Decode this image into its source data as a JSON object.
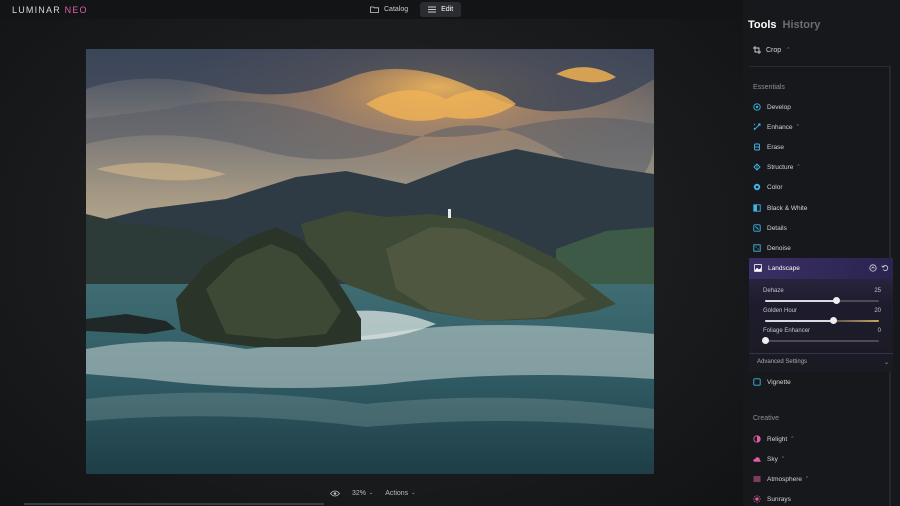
{
  "app": {
    "logo_main": "LUMINAR",
    "logo_accent": "NEO"
  },
  "modes": [
    {
      "label": "Catalog",
      "icon": "folder-icon",
      "active": false
    },
    {
      "label": "Edit",
      "icon": "sliders-icon",
      "active": true
    }
  ],
  "window_controls": [
    "share-icon",
    "minimize-icon",
    "maximize-icon",
    "close-icon"
  ],
  "panel": {
    "tabs": {
      "tools": "Tools",
      "history": "History"
    },
    "crop": {
      "label": "Crop"
    },
    "essentials": {
      "title": "Essentials",
      "items": [
        {
          "label": "Develop",
          "icon": "develop-icon",
          "color": "#3db7e8"
        },
        {
          "label": "Enhance",
          "icon": "enhance-icon",
          "color": "#3db7e8",
          "dropdown": true
        },
        {
          "label": "Erase",
          "icon": "erase-icon",
          "color": "#3db7e8"
        },
        {
          "label": "Structure",
          "icon": "structure-icon",
          "color": "#3db7e8",
          "dropdown": true
        },
        {
          "label": "Color",
          "icon": "color-icon",
          "color": "#3db7e8"
        },
        {
          "label": "Black & White",
          "icon": "black-white-icon",
          "color": "#3db7e8"
        },
        {
          "label": "Details",
          "icon": "details-icon",
          "color": "#3db7e8"
        },
        {
          "label": "Denoise",
          "icon": "denoise-icon",
          "color": "#3db7e8"
        }
      ]
    },
    "landscape": {
      "label": "Landscape",
      "sliders": [
        {
          "label": "Dehaze",
          "value": "25",
          "fraction": 0.625
        },
        {
          "label": "Golden Hour",
          "value": "20",
          "fraction": 0.6
        },
        {
          "label": "Foliage Enhancer",
          "value": "0",
          "fraction": 0.0
        }
      ],
      "advanced": "Advanced Settings"
    },
    "vignette": {
      "label": "Vignette"
    },
    "creative": {
      "title": "Creative",
      "items": [
        {
          "label": "Relight",
          "icon": "relight-icon",
          "color": "#e05ea8",
          "dropdown": true
        },
        {
          "label": "Sky",
          "icon": "sky-icon",
          "color": "#e05ea8",
          "dropdown": true
        },
        {
          "label": "Atmosphere",
          "icon": "atmosphere-icon",
          "color": "#e05ea8",
          "dropdown": true
        },
        {
          "label": "Sunrays",
          "icon": "sunrays-icon",
          "color": "#e05ea8"
        }
      ]
    }
  },
  "bottombar": {
    "zoom": "32%",
    "actions": "Actions"
  }
}
